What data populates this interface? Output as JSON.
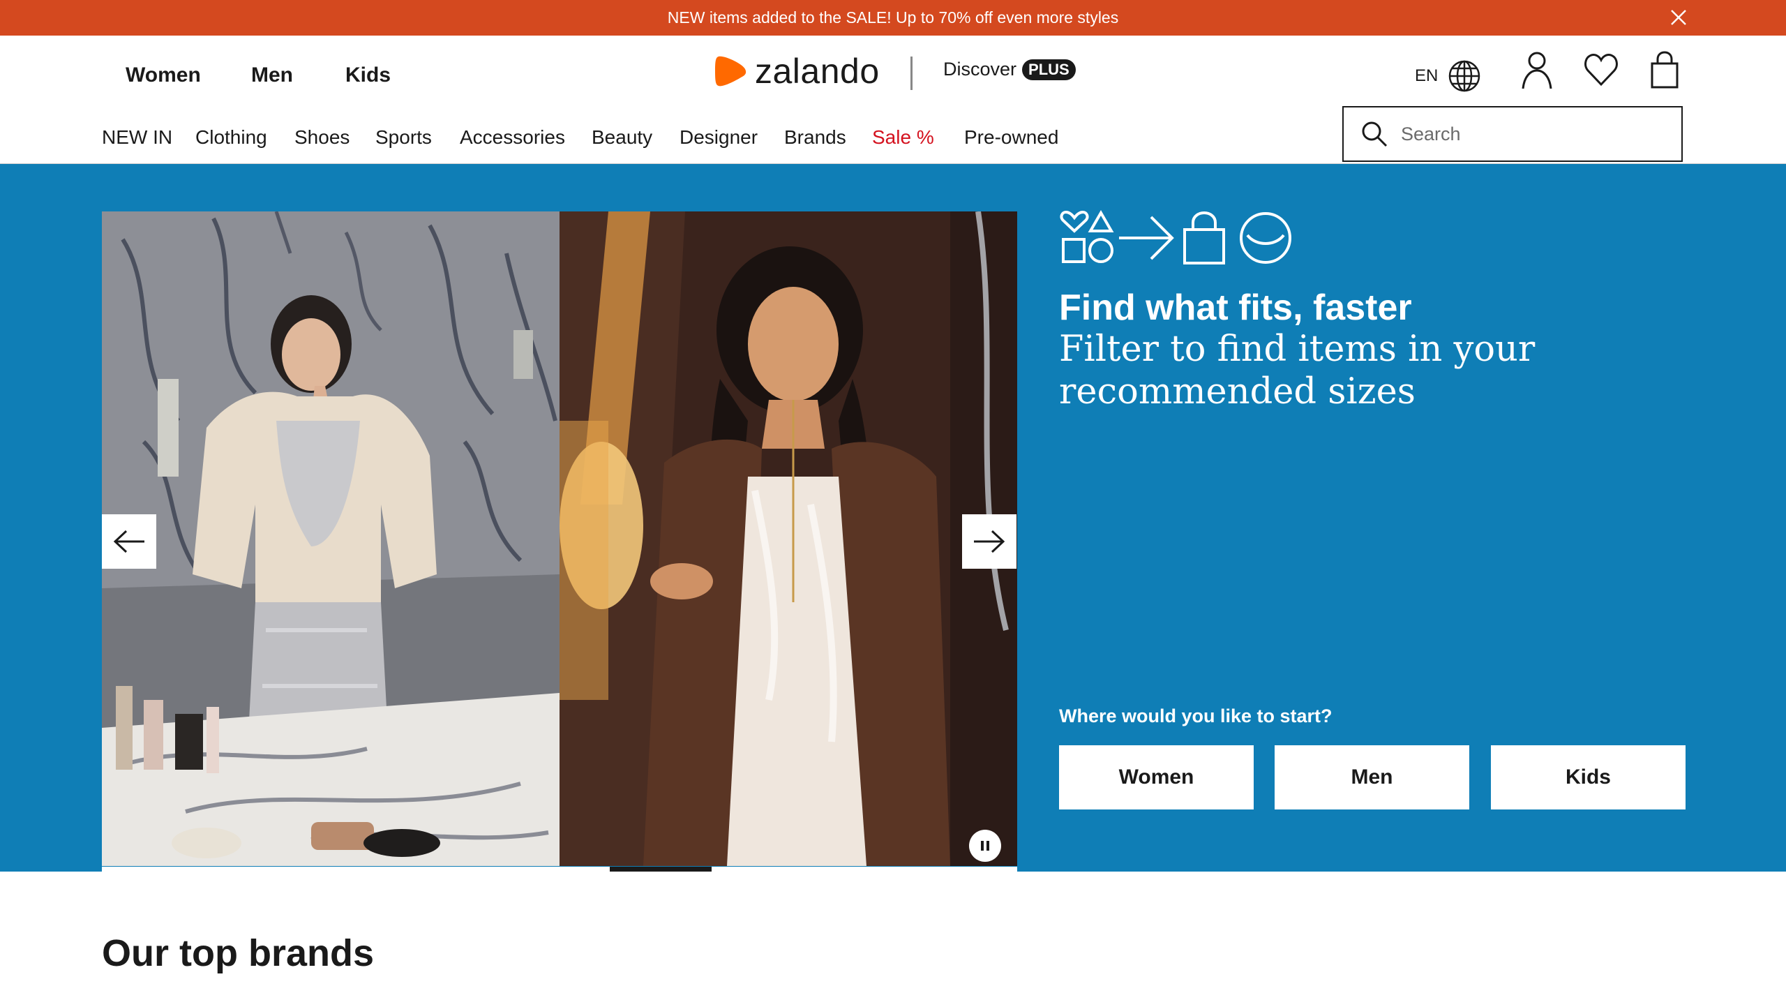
{
  "promo": {
    "text": "NEW items added to the SALE! Up to 70% off even more styles",
    "background": "#d4491f"
  },
  "header": {
    "gender_nav": [
      "Women",
      "Men",
      "Kids"
    ],
    "brand": {
      "name": "zalando",
      "accent": "#ff6900"
    },
    "discover_label": "Discover",
    "plus_badge": "PLUS",
    "language": "EN",
    "icons": [
      "globe-icon",
      "account-icon",
      "wishlist-icon",
      "bag-icon"
    ]
  },
  "category_nav": {
    "items": [
      "NEW IN",
      "Clothing",
      "Shoes",
      "Sports",
      "Accessories",
      "Beauty",
      "Designer",
      "Brands",
      "Sale %",
      "Pre-owned"
    ],
    "sale_color": "#d4111e"
  },
  "search": {
    "placeholder": "Search"
  },
  "hero": {
    "background": "#0f7eb6",
    "icons": [
      "shapes-icon",
      "arrow-right-icon",
      "shopping-bag-icon",
      "smile-icon"
    ],
    "headline": "Find what fits, faster",
    "subline": "Filter to find items in your recommended sizes",
    "question": "Where would you like to start?",
    "choices": [
      "Women",
      "Men",
      "Kids"
    ],
    "carousel": {
      "prev_icon": "arrow-left-icon",
      "next_icon": "arrow-right-icon",
      "pause_icon": "pause-icon"
    }
  },
  "sections": {
    "top_brands_title": "Our top brands"
  }
}
